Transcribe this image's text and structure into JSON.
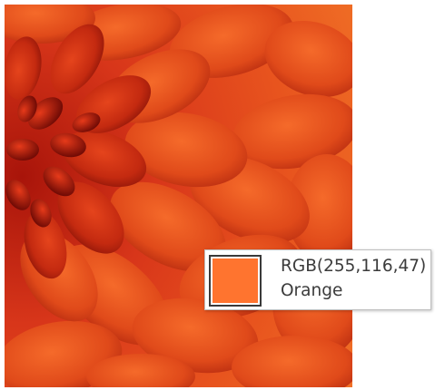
{
  "image": {
    "subject": "flower-petals"
  },
  "color_tooltip": {
    "rgb_label": "RGB(255,116,47)",
    "color_name": "Orange",
    "swatch_color": "#ff742f"
  }
}
